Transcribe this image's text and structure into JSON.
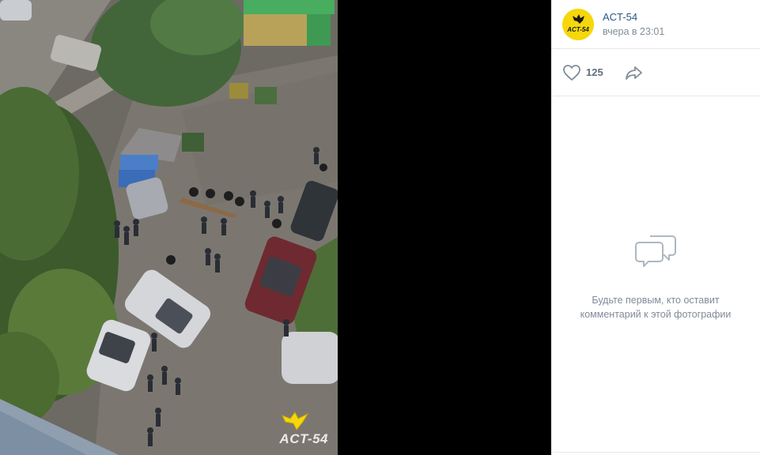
{
  "photo": {
    "watermark": "ACT-54"
  },
  "author": {
    "name": "ACT-54",
    "time": "вчера в 23:01",
    "avatar_icon": "act54-logo-icon",
    "avatar_bg": "#f5d70c"
  },
  "actions": {
    "like_count": "125",
    "like_icon": "heart-icon",
    "share_icon": "share-arrow-icon"
  },
  "comments": {
    "empty_line1": "Будьте первым, кто оставит",
    "empty_line2": "комментарий к этой фотографии",
    "empty_icon": "speech-bubbles-icon"
  },
  "colors": {
    "link": "#2a5885",
    "muted": "#818c99",
    "divider": "#e7e8ec"
  }
}
